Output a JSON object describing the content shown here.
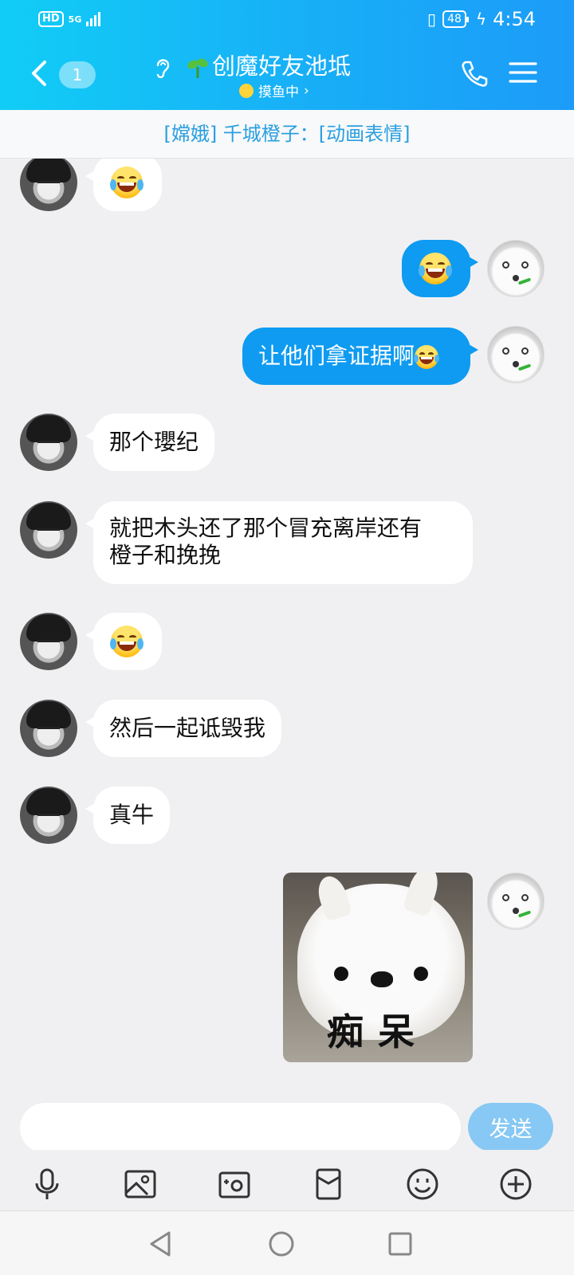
{
  "status_bar": {
    "hd": "HD",
    "network": "5G",
    "battery": "48",
    "time": "4:54"
  },
  "header": {
    "unread_count": "1",
    "title": "创魔好友池坻",
    "subtitle": "摸鱼中",
    "subtitle_arrow": "›"
  },
  "notice": {
    "text": "[嫦娥] 千城橙子：[动画表情]"
  },
  "messages": [
    {
      "side": "left",
      "type": "emoji",
      "emoji": "laughing-tears"
    },
    {
      "side": "right",
      "type": "emoji",
      "emoji": "laughing-tears"
    },
    {
      "side": "right",
      "type": "text",
      "text": "让他们拿证据啊",
      "emoji": "laughing-tears"
    },
    {
      "side": "left",
      "type": "text",
      "text": "那个瓔纪"
    },
    {
      "side": "left",
      "type": "text",
      "text": "就把木头还了那个冒充离岸还有",
      "text2": "橙子和挽挽"
    },
    {
      "side": "left",
      "type": "emoji",
      "emoji": "laughing-tears"
    },
    {
      "side": "left",
      "type": "text",
      "text": "然后一起诋毁我"
    },
    {
      "side": "left",
      "type": "text",
      "text": "真牛"
    },
    {
      "side": "right",
      "type": "sticker",
      "caption": "痴呆"
    }
  ],
  "composer": {
    "placeholder": "",
    "send_label": "发送"
  },
  "toolbar_icons": [
    "microphone-icon",
    "image-icon",
    "camera-icon",
    "red-packet-icon",
    "smiley-icon",
    "plus-icon"
  ],
  "nav_icons": [
    "back-triangle-icon",
    "home-circle-icon",
    "recents-square-icon"
  ],
  "colors": {
    "header_start": "#11cdf6",
    "header_end": "#1c9cf8",
    "bubble_out": "#0e9bf1",
    "bubble_in": "#ffffff",
    "send_button": "#87c8f4",
    "notice_text": "#2a9fe0"
  }
}
